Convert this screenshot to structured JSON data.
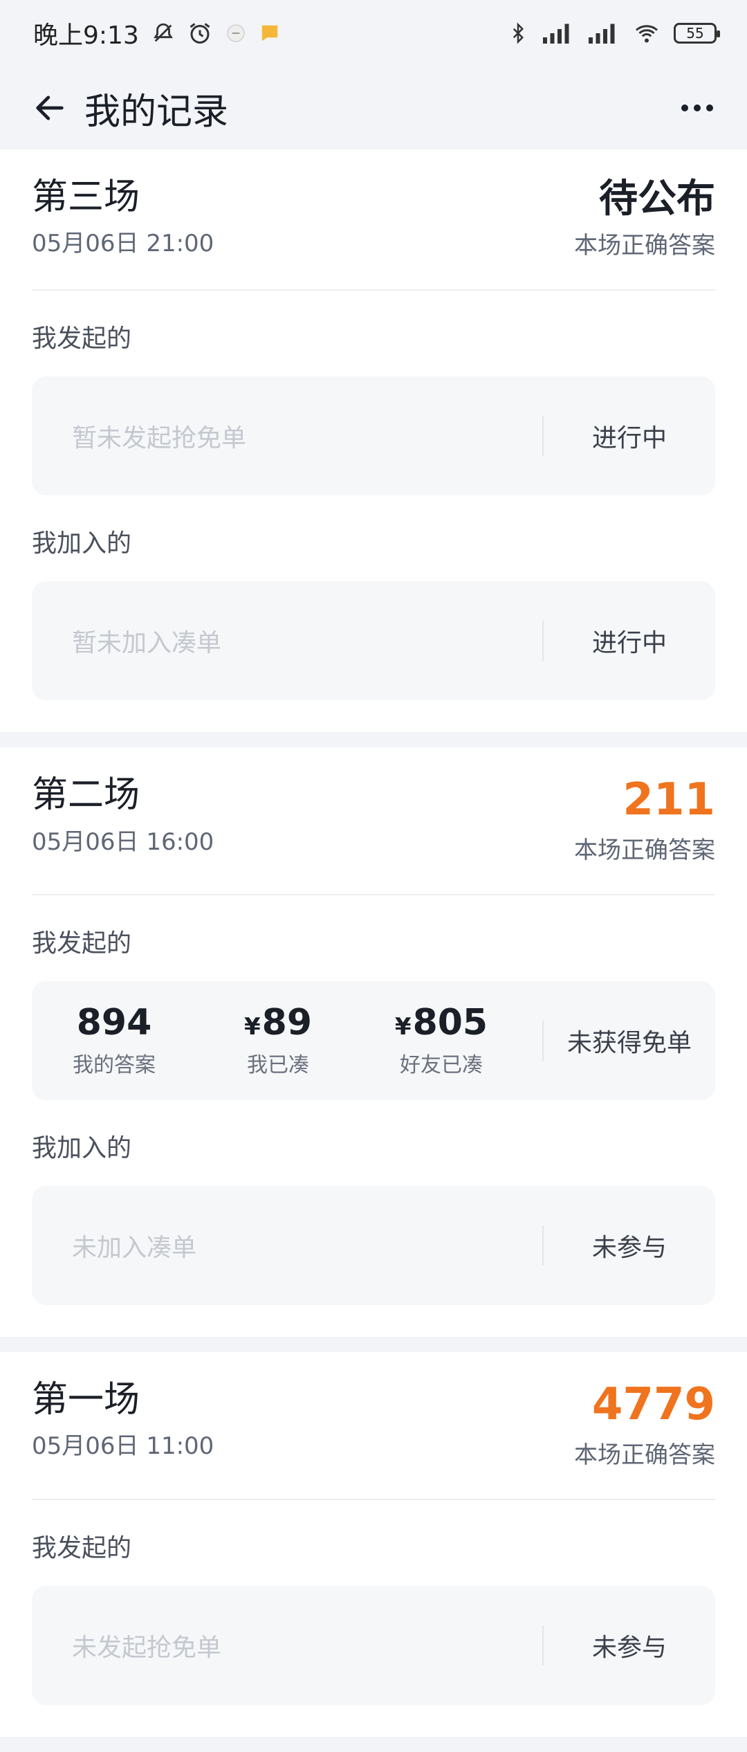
{
  "status_bar": {
    "time": "晚上9:13",
    "battery": "55",
    "icons": [
      "mute-bell-icon",
      "alarm-icon",
      "app-notification-icon",
      "message-icon",
      "bluetooth-icon",
      "signal-hd-icon",
      "signal-hd-icon",
      "wifi-icon",
      "battery-icon"
    ]
  },
  "header": {
    "title": "我的记录",
    "back_icon": "arrow-left-icon",
    "more_icon": "more-dots-icon"
  },
  "colors": {
    "accent_orange": "#f0731e",
    "background": "#f2f4f7",
    "card": "#ffffff"
  },
  "sessions": [
    {
      "name": "第三场",
      "time": "05月06日 21:00",
      "answer": "待公布",
      "answer_label": "本场正确答案",
      "initiated": {
        "label": "我发起的",
        "empty_text": "暂未发起抢免单",
        "status": "进行中"
      },
      "joined": {
        "label": "我加入的",
        "empty_text": "暂未加入凑单",
        "status": "进行中"
      }
    },
    {
      "name": "第二场",
      "time": "05月06日 16:00",
      "answer": "211",
      "answer_label": "本场正确答案",
      "initiated": {
        "label": "我发起的",
        "stats": [
          {
            "value": "894",
            "label": "我的答案"
          },
          {
            "currency": "¥",
            "value": "89",
            "label": "我已凑"
          },
          {
            "currency": "¥",
            "value": "805",
            "label": "好友已凑"
          }
        ],
        "status": "未获得免单"
      },
      "joined": {
        "label": "我加入的",
        "empty_text": "未加入凑单",
        "status": "未参与"
      }
    },
    {
      "name": "第一场",
      "time": "05月06日 11:00",
      "answer": "4779",
      "answer_label": "本场正确答案",
      "initiated": {
        "label": "我发起的",
        "empty_text": "未发起抢免单",
        "status": "未参与"
      }
    }
  ]
}
